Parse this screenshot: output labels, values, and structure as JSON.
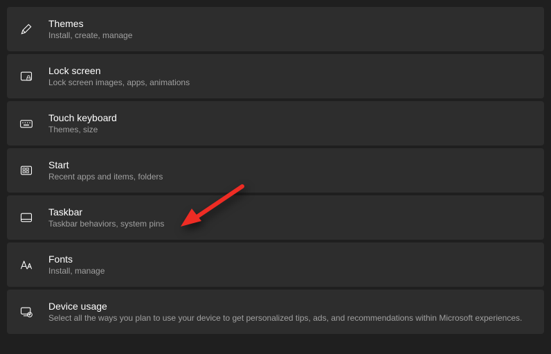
{
  "items": [
    {
      "title": "Themes",
      "desc": "Install, create, manage"
    },
    {
      "title": "Lock screen",
      "desc": "Lock screen images, apps, animations"
    },
    {
      "title": "Touch keyboard",
      "desc": "Themes, size"
    },
    {
      "title": "Start",
      "desc": "Recent apps and items, folders"
    },
    {
      "title": "Taskbar",
      "desc": "Taskbar behaviors, system pins"
    },
    {
      "title": "Fonts",
      "desc": "Install, manage"
    },
    {
      "title": "Device usage",
      "desc": "Select all the ways you plan to use your device to get personalized tips, ads, and recommendations within Microsoft experiences."
    }
  ],
  "arrow": {
    "color": "#ee2c24"
  }
}
